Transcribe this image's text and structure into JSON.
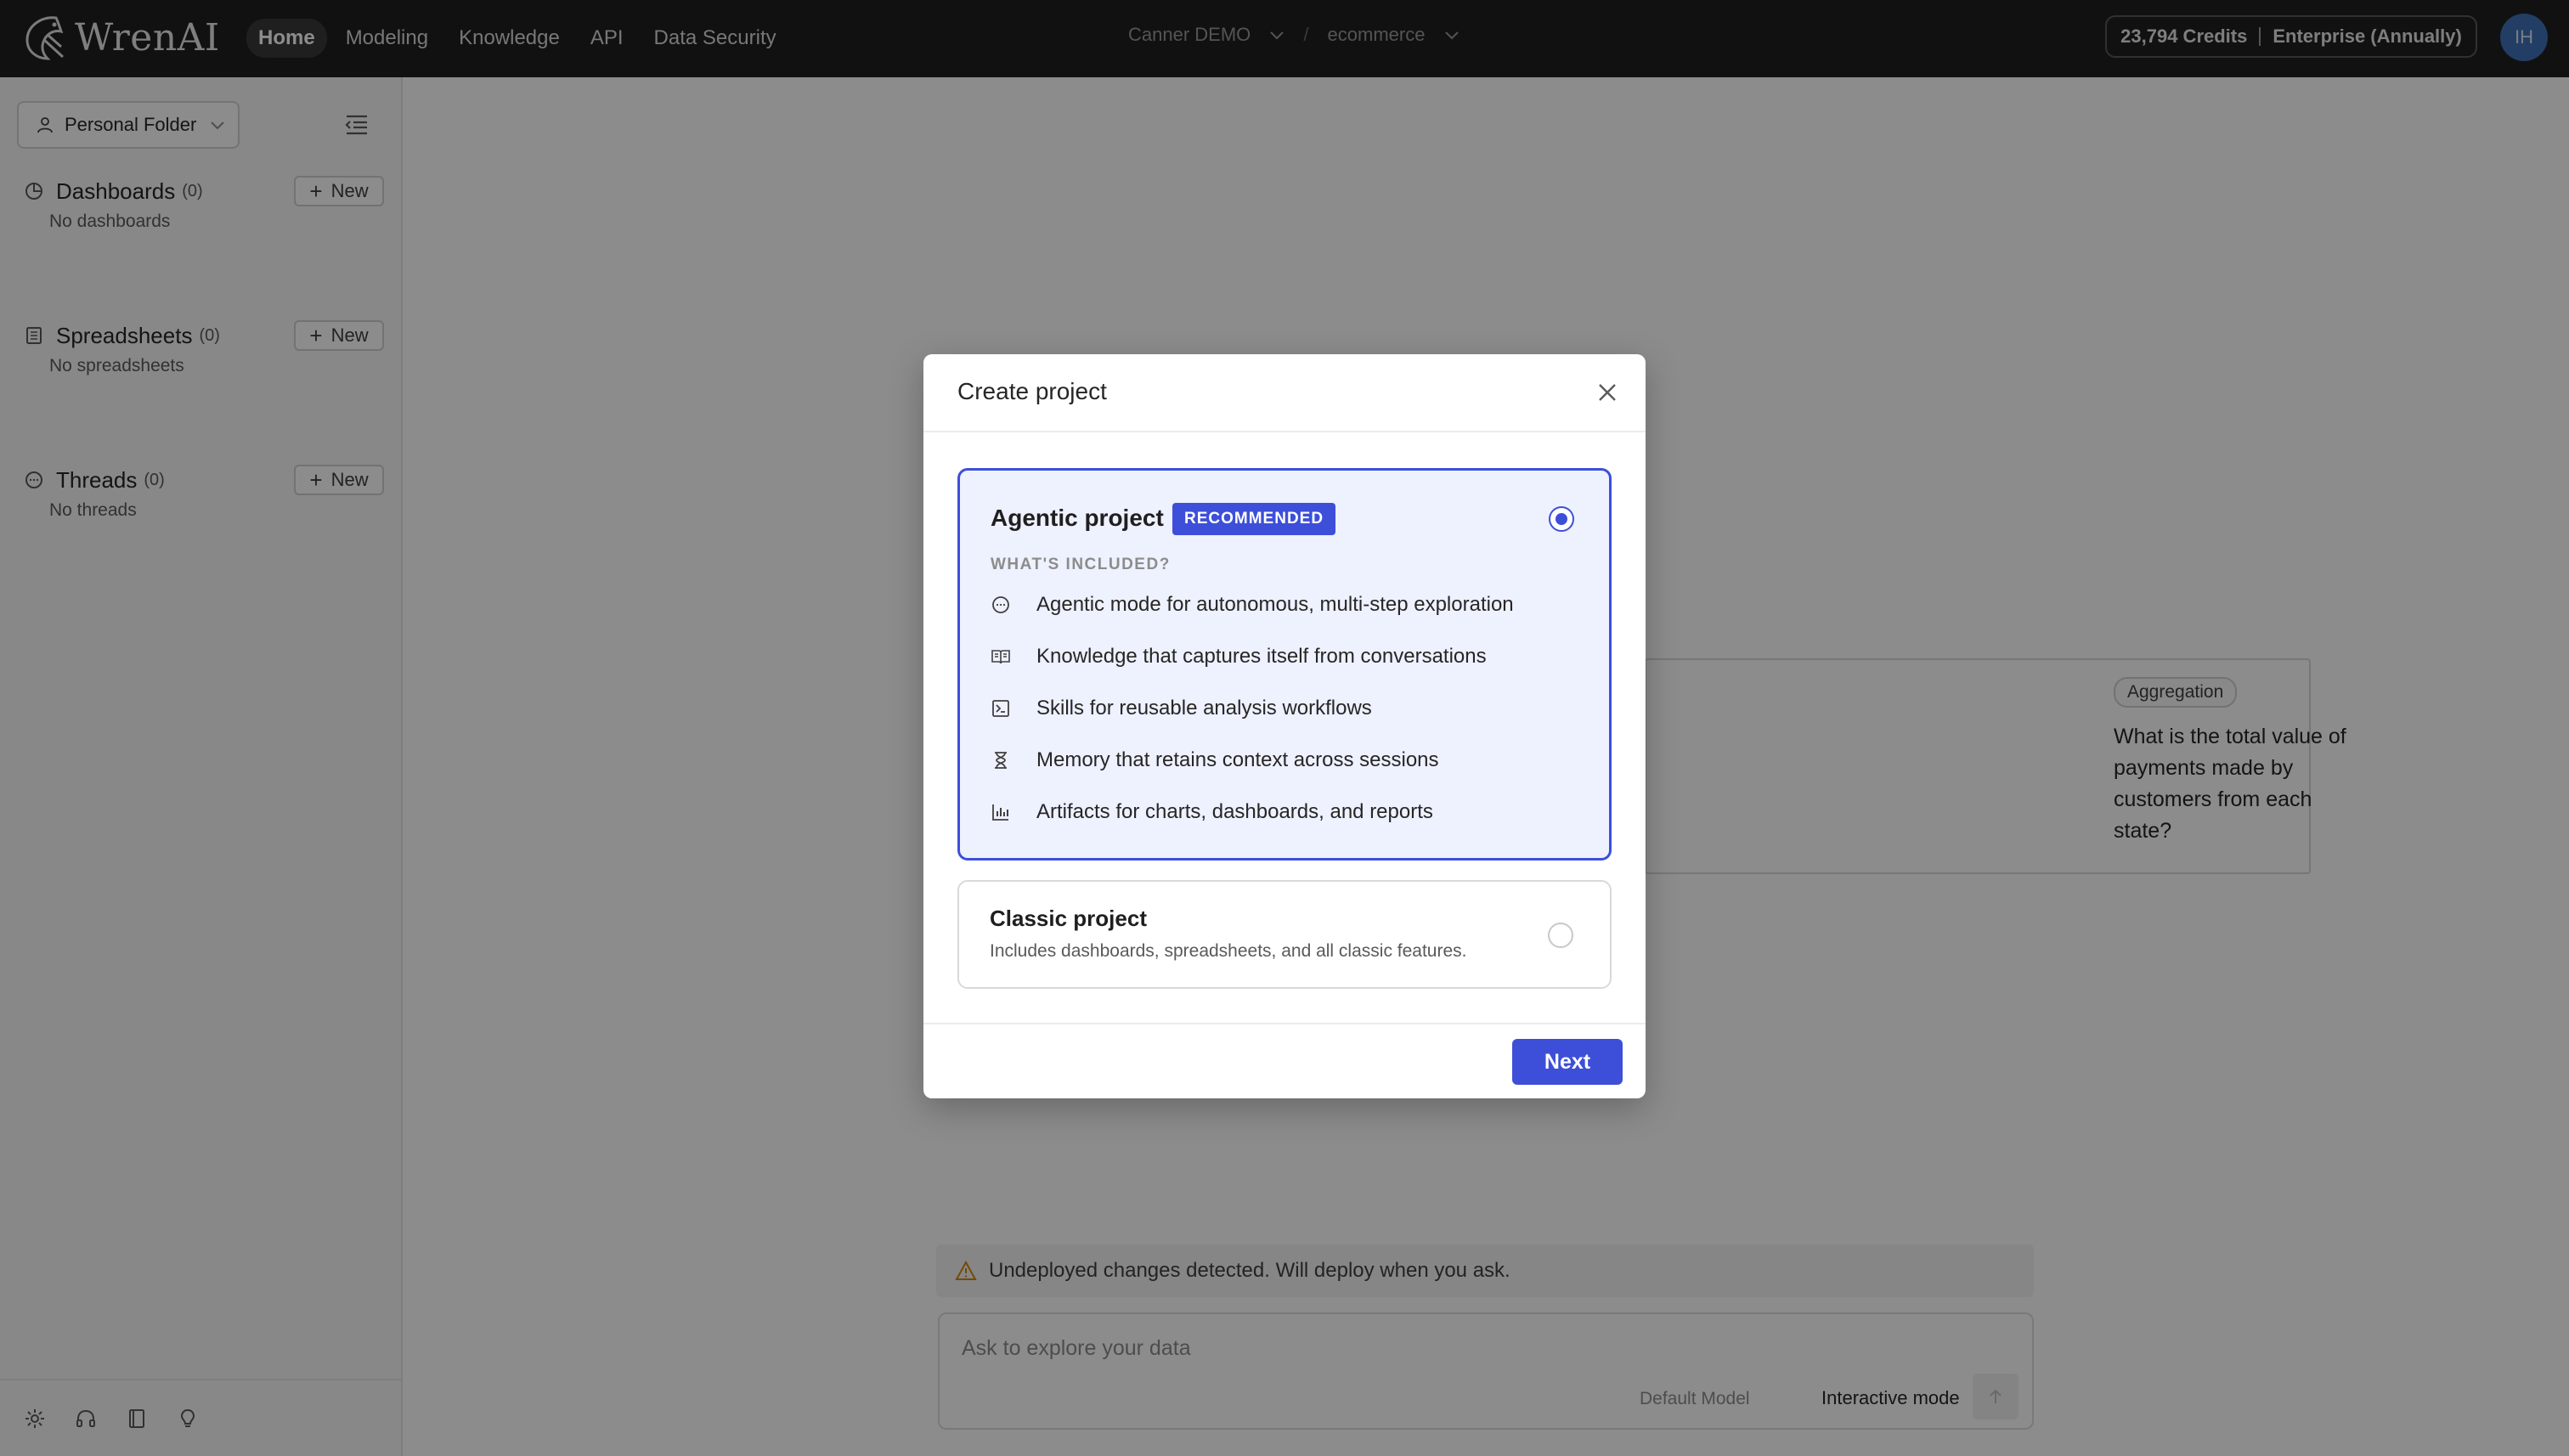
{
  "brand": {
    "name": "WrenAI"
  },
  "nav": {
    "items": [
      {
        "label": "Home",
        "active": true
      },
      {
        "label": "Modeling",
        "active": false
      },
      {
        "label": "Knowledge",
        "active": false
      },
      {
        "label": "API",
        "active": false
      },
      {
        "label": "Data Security",
        "active": false
      }
    ]
  },
  "project_switcher": {
    "organization": "Canner DEMO",
    "separator": "/",
    "project": "ecommerce"
  },
  "account": {
    "credits": "23,794 Credits",
    "plan": "Enterprise (Annually)",
    "initials": "IH"
  },
  "sidebar": {
    "folder": "Personal Folder",
    "sections": [
      {
        "title": "Dashboards",
        "count": "(0)",
        "new_label": "New",
        "empty_text": "No dashboards"
      },
      {
        "title": "Spreadsheets",
        "count": "(0)",
        "new_label": "New",
        "empty_text": "No spreadsheets"
      },
      {
        "title": "Threads",
        "count": "(0)",
        "new_label": "New",
        "empty_text": "No threads"
      }
    ]
  },
  "main": {
    "recommendation": {
      "tag": "Aggregation",
      "question": "What is the total value of payments made by customers from each state?"
    },
    "warning": "Undeployed changes detected. Will deploy when you ask.",
    "chat": {
      "placeholder": "Ask to explore your data",
      "model_label": "Default Model",
      "mode": "Interactive mode"
    }
  },
  "modal": {
    "title": "Create project",
    "agentic": {
      "title": "Agentic project",
      "badge": "RECOMMENDED",
      "included_label": "WHAT'S INCLUDED?",
      "selected": true,
      "features": [
        {
          "icon": "chat-bubble-icon",
          "text": "Agentic mode for autonomous, multi-step exploration"
        },
        {
          "icon": "book-icon",
          "text": "Knowledge that captures itself from conversations"
        },
        {
          "icon": "terminal-icon",
          "text": "Skills for reusable analysis workflows"
        },
        {
          "icon": "hourglass-icon",
          "text": "Memory that retains context across sessions"
        },
        {
          "icon": "bar-chart-icon",
          "text": "Artifacts for charts, dashboards, and reports"
        }
      ]
    },
    "classic": {
      "title": "Classic project",
      "description": "Includes dashboards, spreadsheets, and all classic features.",
      "selected": false
    },
    "next_label": "Next"
  },
  "colors": {
    "accent": "#3d4fd8",
    "topbar": "#1f1f1f",
    "sidebar": "#f7f7f7",
    "selected_bg": "#eef1fe"
  }
}
